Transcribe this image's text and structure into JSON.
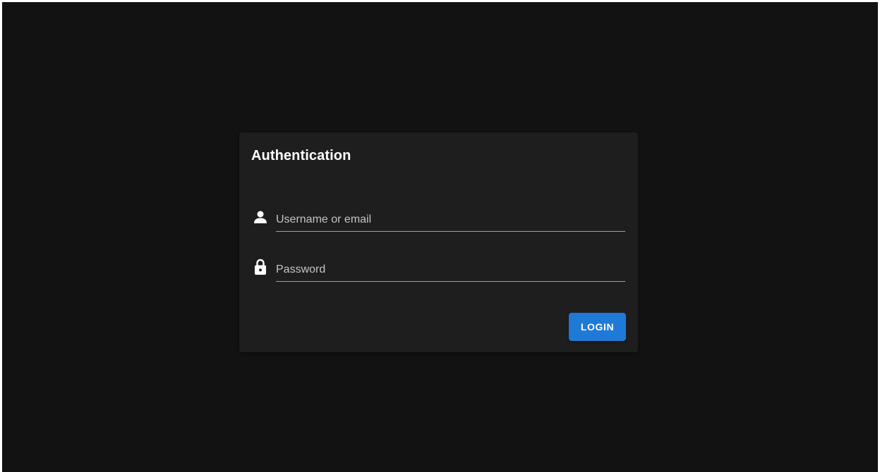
{
  "auth": {
    "title": "Authentication",
    "username": {
      "icon": "person-icon",
      "placeholder": "Username or email",
      "value": ""
    },
    "password": {
      "icon": "lock-icon",
      "placeholder": "Password",
      "value": ""
    },
    "login_label": "LOGIN"
  },
  "colors": {
    "background": "#121212",
    "card": "#1e1e1e",
    "accent": "#1e7ad6",
    "text": "#ffffff",
    "placeholder": "#c4c4c4",
    "underline": "#a0a0a0"
  }
}
